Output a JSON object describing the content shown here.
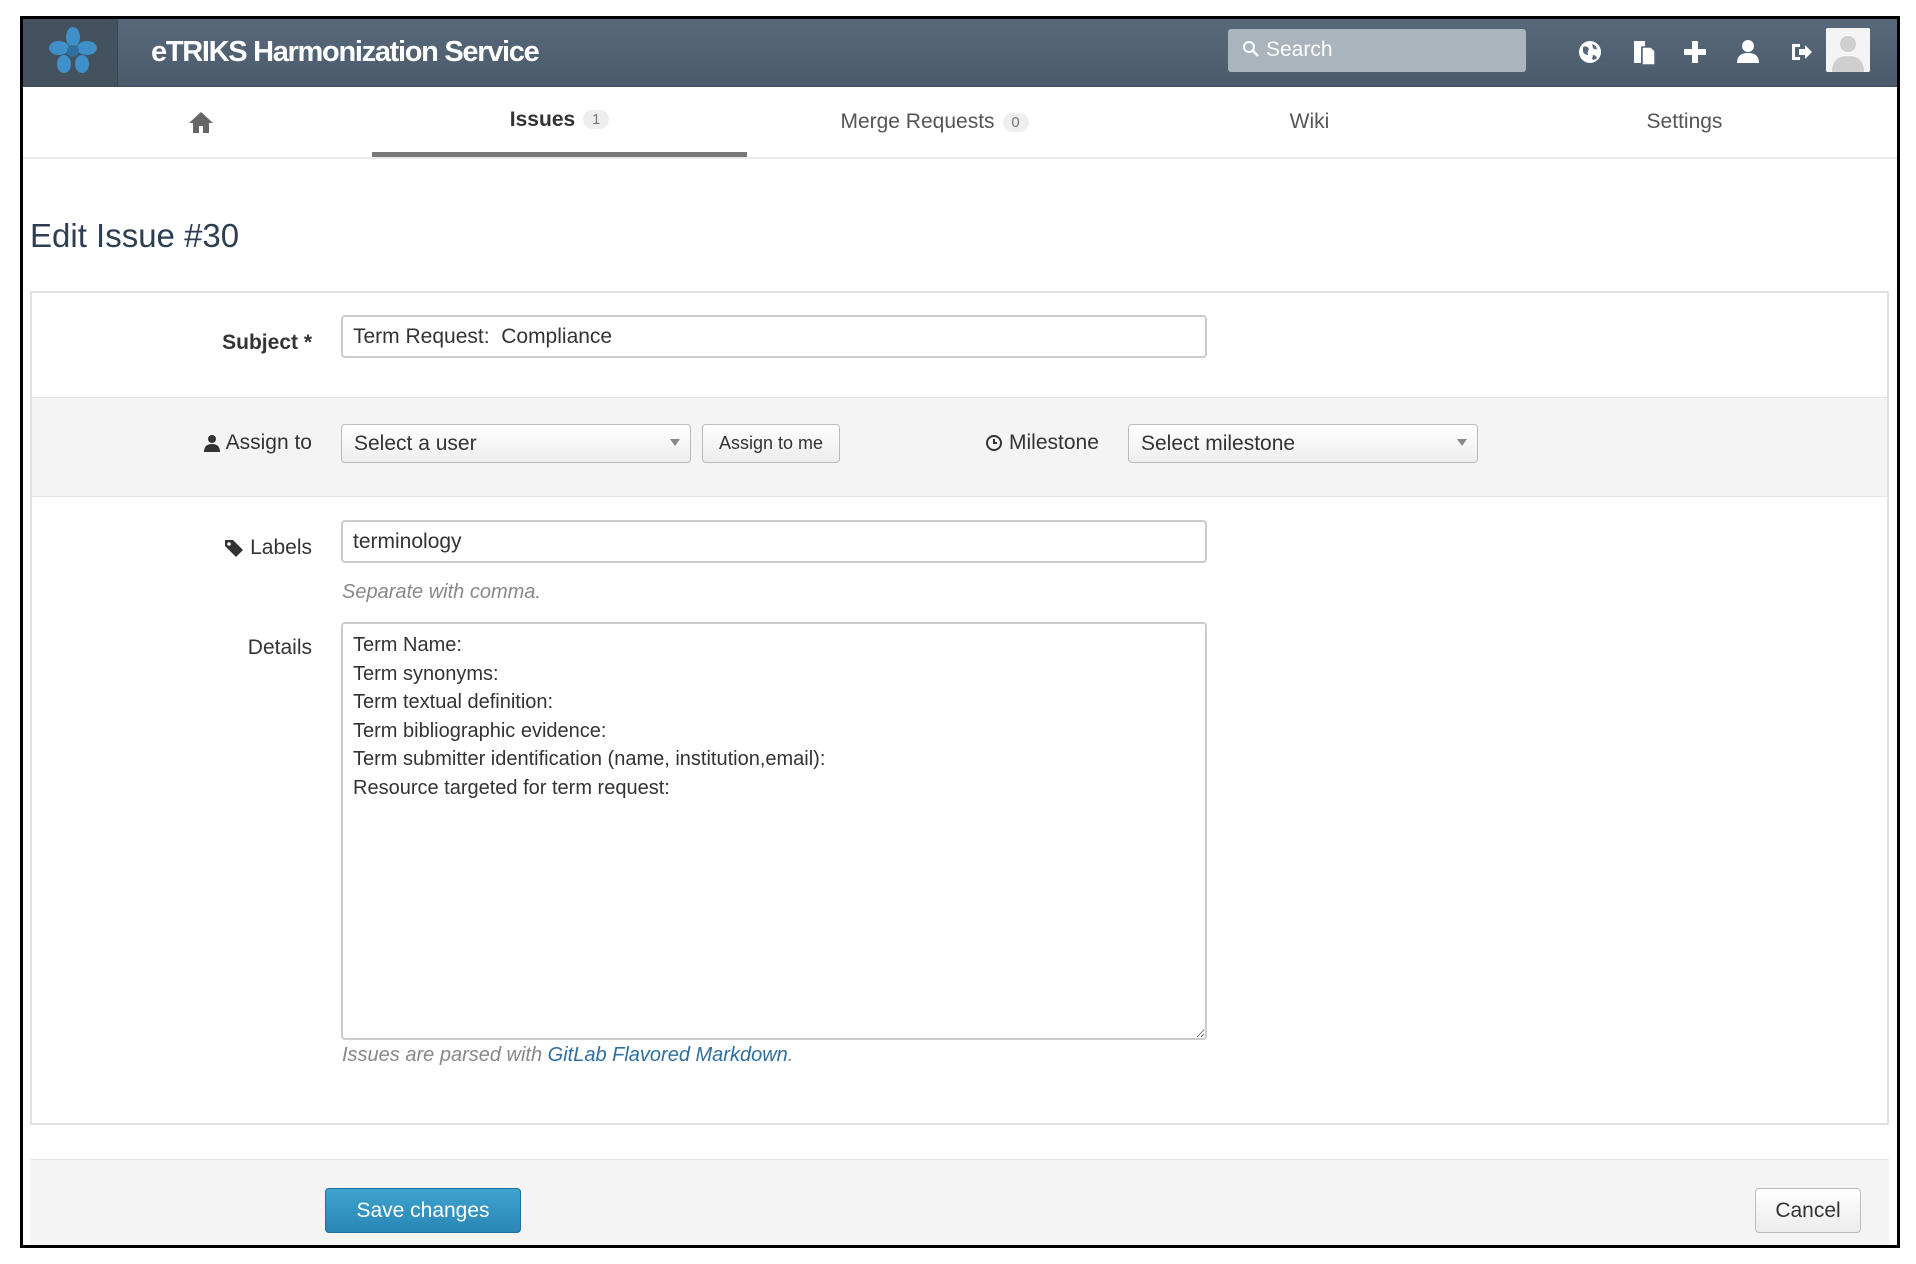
{
  "header": {
    "app_title": "eTRIKS Harmonization Service",
    "search_placeholder": "Search",
    "icons": [
      "globe-icon",
      "copy-icon",
      "plus-icon",
      "user-icon",
      "sign-out-icon",
      "avatar"
    ]
  },
  "tabs": [
    {
      "label": "",
      "icon": "home-icon"
    },
    {
      "label": "Issues",
      "count": "1",
      "active": true
    },
    {
      "label": "Merge Requests",
      "count": "0"
    },
    {
      "label": "Wiki"
    },
    {
      "label": "Settings"
    }
  ],
  "page": {
    "title": "Edit Issue #30"
  },
  "form": {
    "subject": {
      "label": "Subject *",
      "value": "Term Request:  Compliance"
    },
    "assign": {
      "label": "Assign to",
      "select_value": "Select a user",
      "assign_me_label": "Assign to me"
    },
    "milestone": {
      "label": "Milestone",
      "select_value": "Select milestone"
    },
    "labels": {
      "label": "Labels",
      "value": "terminology",
      "help": "Separate with comma."
    },
    "details": {
      "label": "Details",
      "value": "Term Name:\nTerm synonyms:\nTerm textual definition:\nTerm bibliographic evidence:\nTerm submitter identification (name, institution,email):\nResource targeted for term request:",
      "help_prefix": "Issues are parsed with ",
      "help_link": "GitLab Flavored Markdown",
      "help_suffix": "."
    }
  },
  "footer": {
    "save_label": "Save changes",
    "cancel_label": "Cancel"
  },
  "colors": {
    "navbar": "#4f6071",
    "primary_button": "#2f8fc0",
    "link": "#2f6f9f"
  }
}
